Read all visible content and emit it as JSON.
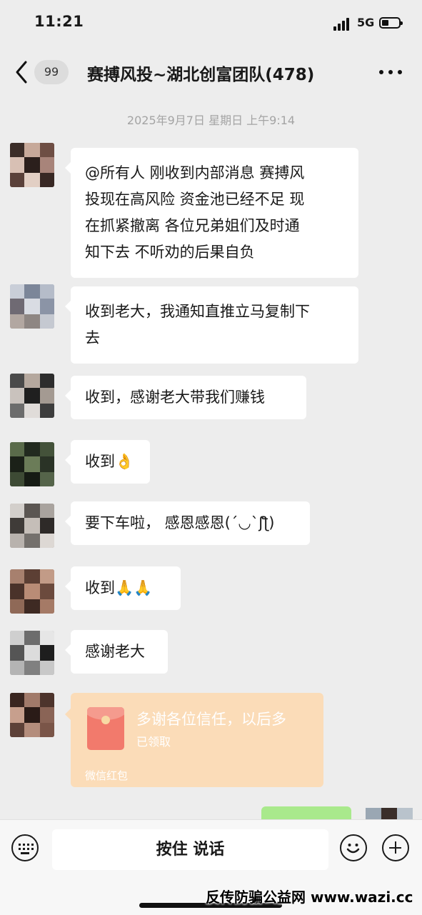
{
  "status_bar": {
    "time": "11:21",
    "network": "5G"
  },
  "nav": {
    "back_badge": "99",
    "title": "赛搏风投~湖北创富团队(478)"
  },
  "timestamp": "2025年9月7日 星期日 上午9:14",
  "messages": [
    {
      "lines": [
        "@所有人 刚收到内部消息 赛搏风",
        "投现在高风险 资金池已经不足 现",
        "在抓紧撤离 各位兄弟姐们及时通",
        "知下去 不听劝的后果自负"
      ]
    },
    {
      "lines": [
        "收到老大，我通知直推立马复制下",
        "去"
      ]
    },
    {
      "lines": [
        "收到，感谢老大带我们赚钱"
      ]
    },
    {
      "lines": [
        "收到👌"
      ]
    },
    {
      "lines": [
        "要下车啦， 感恩感恩(´◡`ʃƪ)"
      ]
    },
    {
      "lines": [
        "收到🙏🙏"
      ]
    },
    {
      "lines": [
        "感谢老大"
      ]
    }
  ],
  "red_packet": {
    "title": "多谢各位信任，以后多",
    "status": "已领取",
    "footer": "微信红包"
  },
  "input_bar": {
    "hold_to_talk": "按住 说话"
  },
  "watermark": "反传防骗公益网 www.wazi.cc",
  "colors": {
    "background": "#ededed",
    "bubble": "#ffffff",
    "red_packet": "#fbdcb8",
    "sent_bubble": "#a9e98c"
  }
}
